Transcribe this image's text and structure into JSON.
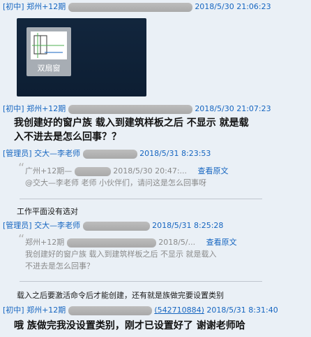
{
  "messages": [
    {
      "role": "[初中]",
      "name": "郑州+12期",
      "time": "2018/5/30 21:06:23"
    },
    {
      "role": "[初中]",
      "name": "郑州+12期",
      "time": "2018/5/30 21:07:23"
    },
    {
      "role": "[管理员]",
      "name": "交大—李老师",
      "time": "2018/5/31 8:23:53"
    },
    {
      "role": "[管理员]",
      "name": "交大—李老师",
      "time": "2018/5/31 8:25:28"
    },
    {
      "role": "[初中]",
      "name": "郑州+12期",
      "qq": "(542710884)",
      "time": "2018/5/31 8:31:40"
    }
  ],
  "file_tile": {
    "label": "双扇窗"
  },
  "msg2_text_line1": "我创建好的窗户族  载入到建筑样板之后  不显示  就是载",
  "msg2_text_line2": "入不进去是怎么回事？？",
  "quote1": {
    "header": "广州+12期—",
    "header_time": "2018/5/30 20:47:...",
    "view": "查看原文",
    "body": "@交大—李老师 老师 小伙伴们，请问这是怎么回事呀"
  },
  "reply1": "工作平面没有选对",
  "quote2": {
    "header": "郑州+12期",
    "header_time": "2018/5/...",
    "view": "查看原文",
    "body_line1": "我创建好的窗户族 载入到建筑样板之后 不显示 就是载入",
    "body_line2": "不进去是怎么回事？"
  },
  "reply2": "载入之后要激活命令后才能创建，还有就是族做完要设置类别",
  "msg5_text": "哦    族做完我没设置类别，刚才已设置好了    谢谢老师哈"
}
